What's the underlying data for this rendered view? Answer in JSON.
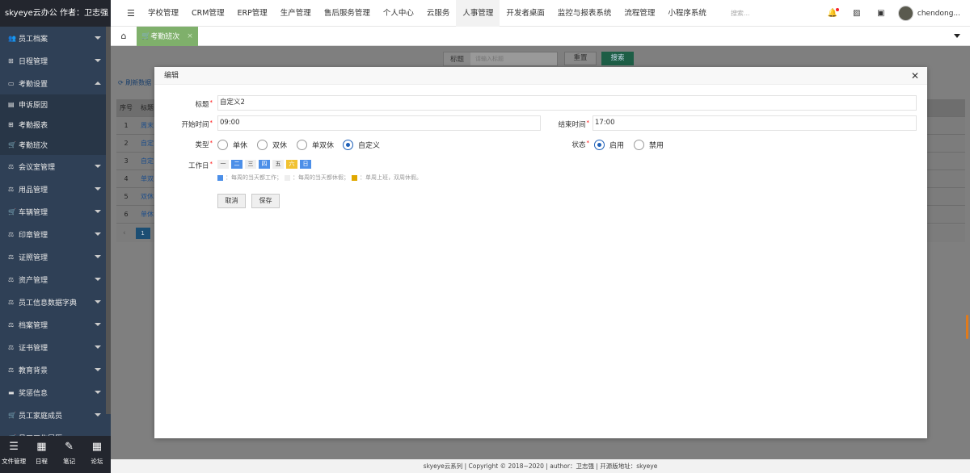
{
  "app": {
    "title": "skyeye云办公 作者：卫志强"
  },
  "sidebar": {
    "items": [
      {
        "label": "员工档案",
        "icon": "users-icon",
        "glyph": "👥",
        "expanded": false
      },
      {
        "label": "日程管理",
        "icon": "table-icon",
        "glyph": "⊞",
        "expanded": false
      },
      {
        "label": "考勤设置",
        "icon": "keyboard-icon",
        "glyph": "▭",
        "expanded": true
      }
    ],
    "subitems": [
      {
        "label": "申诉原因",
        "icon": "doc-icon",
        "glyph": "▤"
      },
      {
        "label": "考勤报表",
        "icon": "table-icon",
        "glyph": "⊞"
      },
      {
        "label": "考勤班次",
        "icon": "cart-icon",
        "glyph": "🛒"
      }
    ],
    "items2": [
      {
        "label": "会议室管理",
        "icon": "balance-icon",
        "glyph": "⚖"
      },
      {
        "label": "用品管理",
        "icon": "balance-icon",
        "glyph": "⚖"
      },
      {
        "label": "车辆管理",
        "icon": "cart-icon",
        "glyph": "🛒"
      },
      {
        "label": "印章管理",
        "icon": "balance-icon",
        "glyph": "⚖"
      },
      {
        "label": "证照管理",
        "icon": "balance-icon",
        "glyph": "⚖"
      },
      {
        "label": "资产管理",
        "icon": "balance-icon",
        "glyph": "⚖"
      },
      {
        "label": "员工信息数据字典",
        "icon": "balance-icon",
        "glyph": "⚖"
      },
      {
        "label": "档案管理",
        "icon": "balance-icon",
        "glyph": "⚖"
      },
      {
        "label": "证书管理",
        "icon": "balance-icon",
        "glyph": "⚖"
      },
      {
        "label": "教育背景",
        "icon": "balance-icon",
        "glyph": "⚖"
      },
      {
        "label": "奖惩信息",
        "icon": "archive-icon",
        "glyph": "▬"
      },
      {
        "label": "员工家庭成员",
        "icon": "cart-icon",
        "glyph": "🛒"
      },
      {
        "label": "员工工作履历",
        "icon": "cart-icon",
        "glyph": "🛒"
      }
    ],
    "footer_buttons": [
      {
        "label": "文件管理",
        "icon": "list-icon",
        "glyph": "☰"
      },
      {
        "label": "日程",
        "icon": "calendar-icon",
        "glyph": "▦"
      },
      {
        "label": "笔记",
        "icon": "edit-icon",
        "glyph": "✎"
      },
      {
        "label": "论坛",
        "icon": "calendar-icon",
        "glyph": "▦"
      }
    ]
  },
  "topnav": {
    "items": [
      "学校管理",
      "CRM管理",
      "ERP管理",
      "生产管理",
      "售后服务管理",
      "个人中心",
      "云服务",
      "人事管理",
      "开发者桌面",
      "监控与报表系统",
      "流程管理",
      "小程序系统"
    ],
    "active_index": 7,
    "search_placeholder": "搜索...",
    "username": "chendong..."
  },
  "tabs": {
    "active_label": "考勤班次"
  },
  "background": {
    "search_label": "标题",
    "search_placeholder": "请输入标题",
    "reset_label": "重置",
    "query_label": "搜索",
    "refresh_label": "刷新数据",
    "col_headers": [
      "序号",
      "标题"
    ],
    "rows": [
      {
        "no": "1",
        "title": "周末"
      },
      {
        "no": "2",
        "title": "自定"
      },
      {
        "no": "3",
        "title": "自定"
      },
      {
        "no": "4",
        "title": "单双"
      },
      {
        "no": "5",
        "title": "双休"
      },
      {
        "no": "6",
        "title": "单休"
      }
    ],
    "pager": {
      "prev": "‹",
      "page": "1"
    }
  },
  "dialog": {
    "title": "编辑",
    "title_label": "标题",
    "title_value": "自定义2",
    "start_label": "开始时间",
    "start_value": "09:00",
    "end_label": "结束时间",
    "end_value": "17:00",
    "type_label": "类型",
    "type_options": [
      "单休",
      "双休",
      "单双休",
      "自定义"
    ],
    "type_selected": 3,
    "status_label": "状态",
    "status_options": [
      "启用",
      "禁用"
    ],
    "status_selected": 0,
    "workday_label": "工作日",
    "days": [
      {
        "d": "一",
        "state": "gray"
      },
      {
        "d": "二",
        "state": "blue"
      },
      {
        "d": "三",
        "state": "gray"
      },
      {
        "d": "四",
        "state": "blue"
      },
      {
        "d": "五",
        "state": "gray"
      },
      {
        "d": "六",
        "state": "yellow"
      },
      {
        "d": "日",
        "state": "blue"
      }
    ],
    "legend": [
      "：每周的当天都工作；",
      "：每周的当天都休假；",
      "：单周上班，双周休假。"
    ],
    "cancel_label": "取消",
    "save_label": "保存"
  },
  "footer": {
    "text": "skyeye云系列 | Copyright © 2018~2020 | author：卫志强 | 开源版地址：skyeye"
  },
  "colors": {
    "sidebar": "#2f4056",
    "accent": "#1e60b8",
    "tab_active": "#7fb06b",
    "day_blue": "#4c8fe8",
    "day_yellow": "#f1c232"
  }
}
